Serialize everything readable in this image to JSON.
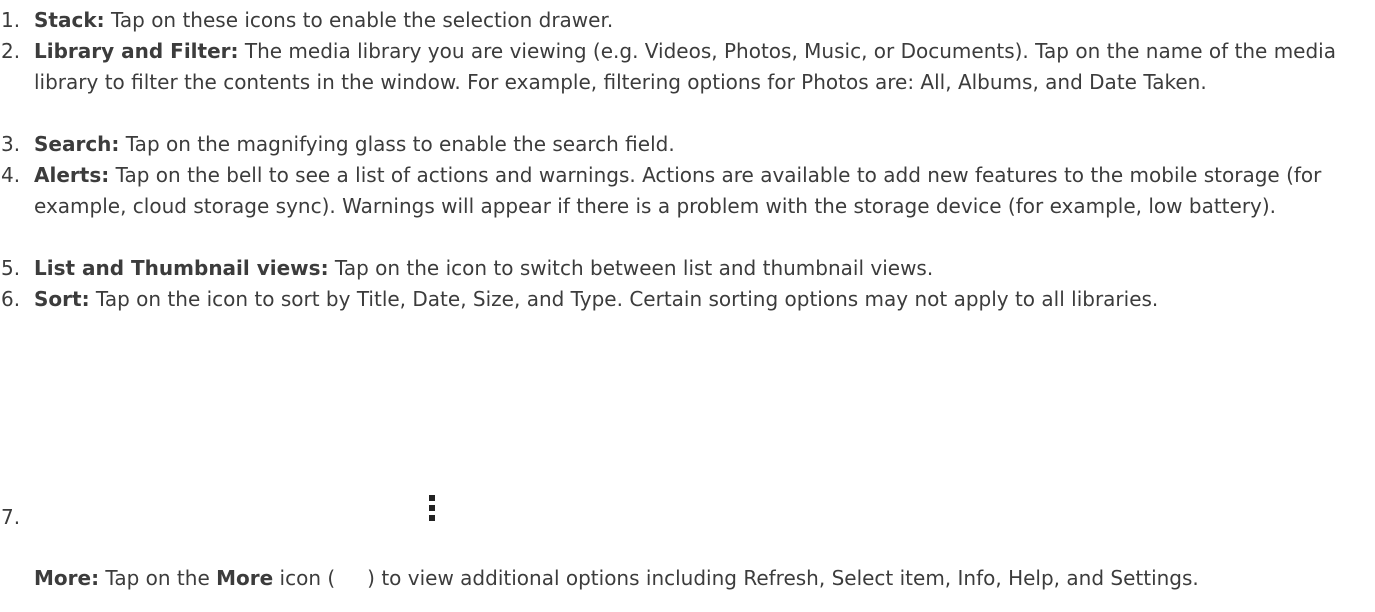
{
  "items": [
    {
      "num": "1.",
      "term": "Stack:",
      "text": " Tap on these icons to enable the selection drawer."
    },
    {
      "num": "2.",
      "term": "Library and Filter:",
      "text": " The media library you are viewing (e.g. Videos, Photos, Music, or Documents). Tap on the name of the media library to filter the contents in the window. For example, filtering options for Photos are: All, Albums, and Date Taken."
    },
    {
      "num": "3.",
      "term": "Search:",
      "text": " Tap on the magnifying glass to enable the search field."
    },
    {
      "num": "4.",
      "term": "Alerts:",
      "text": " Tap on the bell to see a list of actions and warnings. Actions are available to add new features to the mobile storage (for example, cloud storage sync). Warnings will appear if there is a problem with the storage device (for example, low battery)."
    },
    {
      "num": "5.",
      "term": "List and Thumbnail views:",
      "text": " Tap on the icon to switch between list and thumbnail views."
    },
    {
      "num": "6.",
      "term": "Sort:",
      "text": " Tap on the icon to sort by Title, Date, Size, and Type. Certain sorting options may not apply to all libraries."
    }
  ],
  "more_item": {
    "num": "7.",
    "term": "More:",
    "text_before": " Tap on the ",
    "term_inline": "More",
    "text_icon_open": " icon (",
    "text_icon_close": ") to view additional options including Refresh, Select item, Info, Help, and Settings.",
    "icon": "more-vertical-icon"
  },
  "colors": {
    "text": "#3c3c3c",
    "icon": "#222222"
  }
}
